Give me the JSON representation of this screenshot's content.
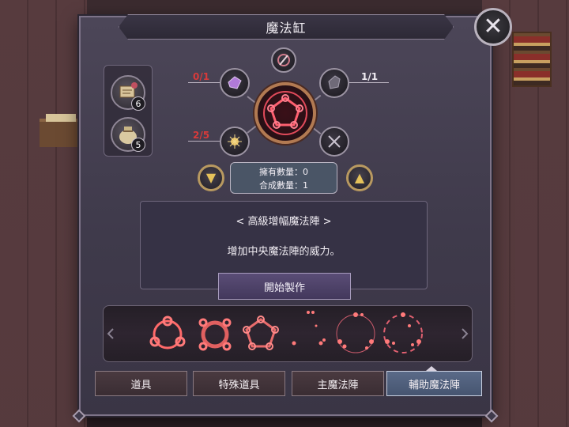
{
  "window": {
    "title": "魔法缸",
    "close_icon": "close-x-icon"
  },
  "inventory": [
    {
      "icon": "scroll-bundle-icon",
      "count": "6"
    },
    {
      "icon": "pouch-icon",
      "count": "5"
    }
  ],
  "slots": {
    "top": {
      "icon": "feather-charm-icon"
    },
    "upper_left": {
      "icon": "purple-crystal-icon",
      "count": "0/1"
    },
    "upper_right": {
      "icon": "dark-stone-icon",
      "count": "1/1"
    },
    "lower_left": {
      "icon": "golden-spark-icon",
      "count": "2/5"
    },
    "lower_right": {
      "icon": "empty-x-icon"
    },
    "center": {
      "icon": "pentagon-magic-circle-icon"
    }
  },
  "quantity": {
    "owned": "擁有數量：0",
    "crafted": "合成數量：1"
  },
  "arrows": {
    "down": "chevron-down-icon",
    "up": "chevron-up-icon"
  },
  "description": {
    "title": "< 高級增幅魔法陣 >",
    "text": "增加中央魔法陣的威力。"
  },
  "craft_button": "開始製作",
  "circles": [
    {
      "icon": "triangle-ring-circle-icon"
    },
    {
      "icon": "square-ring-circle-icon"
    },
    {
      "icon": "pentagon-ring-circle-icon"
    },
    {
      "icon": "scattered-dots-circle-icon"
    },
    {
      "icon": "dotted-ring-circle-icon"
    },
    {
      "icon": "dashed-ring-circle-icon"
    }
  ],
  "tabs": [
    {
      "label": "道具"
    },
    {
      "label": "特殊道具"
    },
    {
      "label": "主魔法陣"
    },
    {
      "label": "輔助魔法陣"
    }
  ],
  "colors": {
    "accent_red": "#d83a3a",
    "gold": "#e5c25a",
    "active_tab": "#5a6a88"
  }
}
